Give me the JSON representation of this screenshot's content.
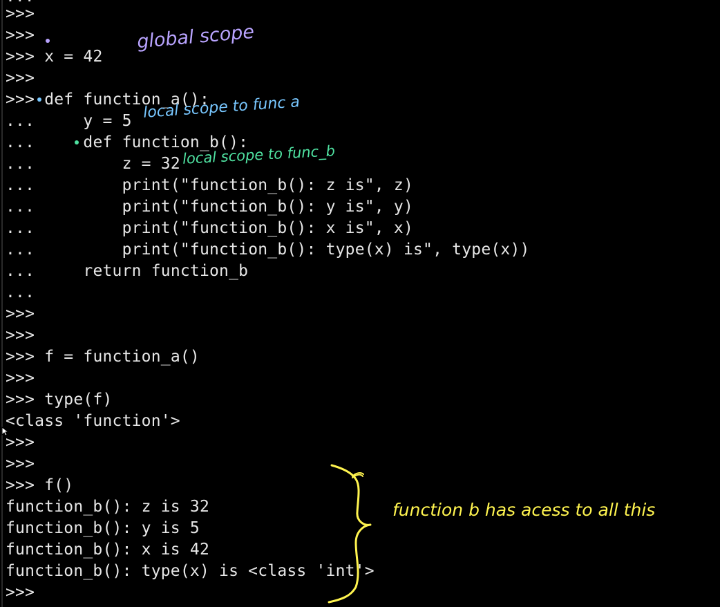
{
  "terminal": {
    "top_partial": "...",
    "lines": [
      {
        "prompt": ">>>",
        "text": ""
      },
      {
        "prompt": ">>>",
        "text": ""
      },
      {
        "prompt": ">>>",
        "text": " x = 42"
      },
      {
        "prompt": ">>>",
        "text": ""
      },
      {
        "prompt": ">>>",
        "text": " def function_a():"
      },
      {
        "prompt": "...",
        "text": "     y = 5"
      },
      {
        "prompt": "...",
        "text": "     def function_b():"
      },
      {
        "prompt": "...",
        "text": "         z = 32"
      },
      {
        "prompt": "...",
        "text": "         print(\"function_b(): z is\", z)"
      },
      {
        "prompt": "...",
        "text": "         print(\"function_b(): y is\", y)"
      },
      {
        "prompt": "...",
        "text": "         print(\"function_b(): x is\", x)"
      },
      {
        "prompt": "...",
        "text": "         print(\"function_b(): type(x) is\", type(x))"
      },
      {
        "prompt": "...",
        "text": "     return function_b"
      },
      {
        "prompt": "...",
        "text": ""
      },
      {
        "prompt": ">>>",
        "text": ""
      },
      {
        "prompt": ">>>",
        "text": ""
      },
      {
        "prompt": ">>>",
        "text": " f = function_a()"
      },
      {
        "prompt": ">>>",
        "text": ""
      },
      {
        "prompt": ">>>",
        "text": " type(f)"
      },
      {
        "prompt": "",
        "text": "<class 'function'>"
      },
      {
        "prompt": ">>>",
        "text": ""
      },
      {
        "prompt": ">>>",
        "text": ""
      },
      {
        "prompt": ">>>",
        "text": " f()"
      },
      {
        "prompt": "",
        "text": "function_b(): z is 32"
      },
      {
        "prompt": "",
        "text": "function_b(): y is 5"
      },
      {
        "prompt": "",
        "text": "function_b(): x is 42"
      },
      {
        "prompt": "",
        "text": "function_b(): type(x) is <class 'int'>"
      },
      {
        "prompt": ">>>",
        "text": ""
      }
    ]
  },
  "annotations": {
    "global_scope": "global scope",
    "local_scope_a": "local scope to func a",
    "local_scope_b": "local scope to func_b",
    "access_note": "function b has acess to all this"
  },
  "colors": {
    "background": "#000000",
    "text": "#e6e6e6",
    "annotation_global": "#b9a4ff",
    "annotation_local_a": "#78c7ff",
    "annotation_local_b": "#4fe2a1",
    "annotation_access": "#fff44f"
  },
  "icons": {
    "cursor": "arrow-cursor-icon"
  }
}
